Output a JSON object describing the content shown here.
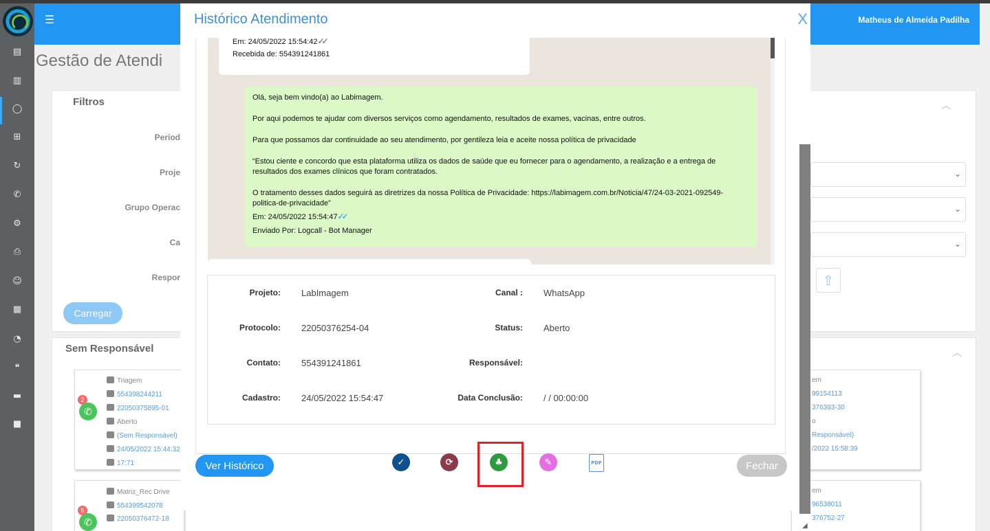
{
  "header": {
    "menu_icon": "hamburger-icon",
    "user_name": "Matheus de Almeida Padilha",
    "accent": "#2196f3"
  },
  "page": {
    "title": "Gestão de Atendi"
  },
  "sidebar": {
    "icons": [
      "briefcase-icon",
      "bar-chart-icon",
      "whatsapp-icon",
      "plus-square-icon",
      "refresh-icon",
      "phone-icon",
      "gear-icon",
      "printer-icon",
      "smile-icon",
      "calendar-icon",
      "dashboard-icon",
      "comments-icon",
      "comment-icon",
      "video-icon"
    ]
  },
  "filters": {
    "title": "Filtros",
    "labels": [
      "Períod",
      "Proje",
      "Grupo Operac",
      "Ca",
      "Respor"
    ],
    "load_button": "Carregar"
  },
  "unassigned": {
    "title": "Sem Responsável",
    "tickets": [
      {
        "badge": "2",
        "group": "Triagem",
        "phone": "554398244211",
        "protocol": "22050375895-01",
        "status": "Aberto",
        "responsible": "(Sem Responsável)",
        "date": "24/05/2022 15:44:32",
        "time": "17:71"
      },
      {
        "badge": "5",
        "group": "Matriz_Rec Drive",
        "phone": "554399542078",
        "protocol": "22050376472-18"
      }
    ],
    "right_texts": [
      "em",
      "99154113",
      "376393-30",
      "o",
      "Responsável)",
      "/2022 15:58:39",
      "em",
      "96538011",
      "376752-27"
    ]
  },
  "modal": {
    "title": "Histórico Atendimento",
    "close": "X",
    "incoming_message": {
      "sent_at": "Em: 24/05/2022 15:54:42",
      "received_from": "Recebida de: 554391241861"
    },
    "outgoing_message": {
      "paragraphs": [
        " Olá, seja bem vindo(a) ao Labimagem.",
        "Por aqui podemos te ajudar com diversos serviços como agendamento, resultados de exames, vacinas, entre outros.",
        "Para que possamos dar continuidade ao seu atendimento, por gentileza leia e aceite nossa política de privacidade",
        "“Estou ciente e concordo que esta plataforma utiliza os dados de saúde que eu fornecer para o agendamento, a realização e a entrega de resultados dos exames clínicos que foram contratados.",
        "O tratamento desses dados seguirá as diretrizes da nossa Política de Privacidade: https://labimagem.com.br/Noticia/47/24-03-2021-092549-politica-de-privacidade”"
      ],
      "sent_at": "Em: 24/05/2022 15:54:47",
      "sent_by": "Enviado Por: Logcall - Bot Manager"
    },
    "details": {
      "projeto_label": "Projeto:",
      "projeto": "LabImagem",
      "canal_label": "Canal :",
      "canal": "WhatsApp",
      "protocolo_label": "Protocolo:",
      "protocolo": "22050376254-04",
      "status_label": "Status:",
      "status": "Aberto",
      "contato_label": "Contato:",
      "contato": "554391241861",
      "responsavel_label": "Responsável:",
      "responsavel": "",
      "cadastro_label": "Cadastro:",
      "cadastro": "24/05/2022 15:54:47",
      "conclusao_label": "Data Conclusão:",
      "conclusao": "/ / 00:00:00"
    },
    "actions": {
      "history_button": "Ver Histórico",
      "close_button": "Fechar",
      "icons": [
        {
          "name": "check-circle-icon",
          "color": "#0d4f8f"
        },
        {
          "name": "transfer-icon",
          "color": "#8b3a4a"
        },
        {
          "name": "sitemap-icon",
          "color": "#2e9b3e"
        },
        {
          "name": "edit-icon",
          "color": "#e36fe3"
        },
        {
          "name": "pdf-icon",
          "color": "#5b8fd6"
        }
      ],
      "pdf_text": "PDF"
    }
  }
}
